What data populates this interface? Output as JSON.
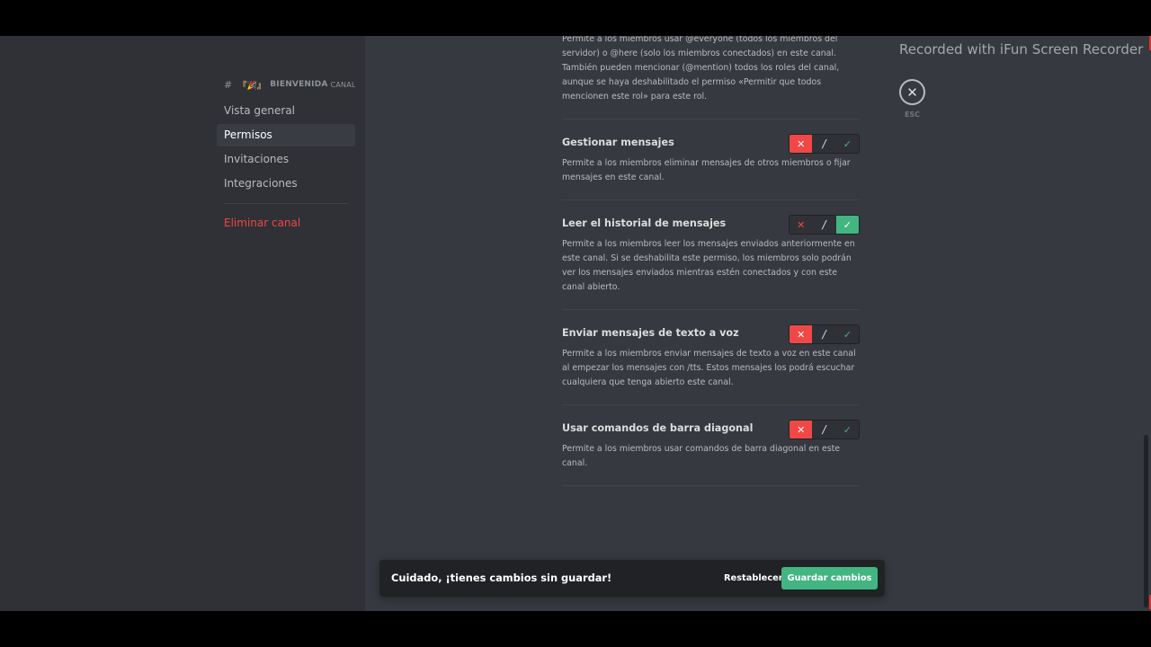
{
  "watermark": "Recorded with iFun Screen Recorder",
  "sidebar": {
    "channel_header": "BIENVENIDA",
    "channel_header_suffix": "CANAL...",
    "channel_emoji": "『🎉』",
    "items": [
      {
        "label": "Vista general"
      },
      {
        "label": "Permisos"
      },
      {
        "label": "Invitaciones"
      },
      {
        "label": "Integraciones"
      }
    ],
    "delete_label": "Eliminar canal"
  },
  "intro_text": "Permite a los miembros usar @everyone (todos los miembros del servidor) o @here (solo los miembros conectados) en este canal. También pueden mencionar (@mention) todos los roles del canal, aunque se haya deshabilitado el permiso «Permitir que todos mencionen este rol» para este rol.",
  "permissions": [
    {
      "title": "Gestionar mensajes",
      "description": "Permite a los miembros eliminar mensajes de otros miembros o fijar mensajes en este canal.",
      "state": "deny"
    },
    {
      "title": "Leer el historial de mensajes",
      "description": "Permite a los miembros leer los mensajes enviados anteriormente en este canal. Si se deshabilita este permiso, los miembros solo podrán ver los mensajes enviados mientras estén conectados y con este canal abierto.",
      "state": "allow"
    },
    {
      "title": "Enviar mensajes de texto a voz",
      "description": "Permite a los miembros enviar mensajes de texto a voz en este canal al empezar los mensajes con /tts. Estos mensajes los podrá escuchar cualquiera que tenga abierto este canal.",
      "state": "deny"
    },
    {
      "title": "Usar comandos de barra diagonal",
      "description": "Permite a los miembros usar comandos de barra diagonal en este canal.",
      "state": "deny"
    }
  ],
  "toggle_symbols": {
    "deny": "✕",
    "neutral": "/",
    "allow": "✓"
  },
  "close": {
    "icon": "✕",
    "label": "ESC"
  },
  "notice": {
    "text": "Cuidado, ¡tienes cambios sin guardar!",
    "reset_label": "Restablecer",
    "save_label": "Guardar cambios"
  },
  "colors": {
    "deny": "#f04747",
    "allow": "#43b581",
    "background": "#36393f",
    "sidebar": "#2f3136"
  }
}
